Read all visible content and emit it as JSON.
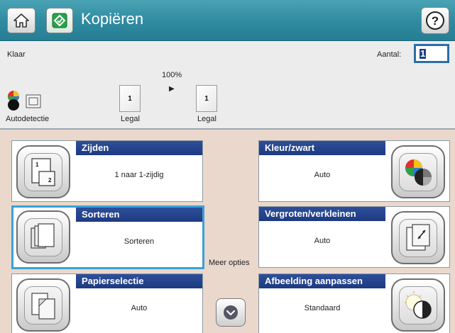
{
  "header": {
    "title": "Kopiëren",
    "icons": {
      "home": "home-icon",
      "copy": "copy-start-icon",
      "help": "help-icon"
    }
  },
  "status": {
    "message": "Klaar",
    "quantity_label": "Aantal:",
    "quantity_value": "1"
  },
  "preview": {
    "zoom": "100%",
    "color_mode": "Autodetectie",
    "source_page_number": "1",
    "source_paper": "Legal",
    "output_page_number": "1",
    "output_paper": "Legal"
  },
  "options": {
    "sides": {
      "title": "Zijden",
      "value": "1 naar 1-zijdig",
      "page_front": "1",
      "page_back": "2"
    },
    "color": {
      "title": "Kleur/zwart",
      "value": "Auto"
    },
    "collate": {
      "title": "Sorteren",
      "value": "Sorteren"
    },
    "resize": {
      "title": "Vergroten/verkleinen",
      "value": "Auto"
    },
    "paper": {
      "title": "Papierselectie",
      "value": "Auto"
    },
    "image_adjust": {
      "title": "Afbeelding aanpassen",
      "value": "Standaard"
    },
    "more_options": "Meer opties"
  },
  "colors": {
    "titlebar": "#2f8aa0",
    "tile_header": "#1d3a82",
    "selected_border": "#3aa0d8",
    "main_background": "#ead8cd"
  }
}
